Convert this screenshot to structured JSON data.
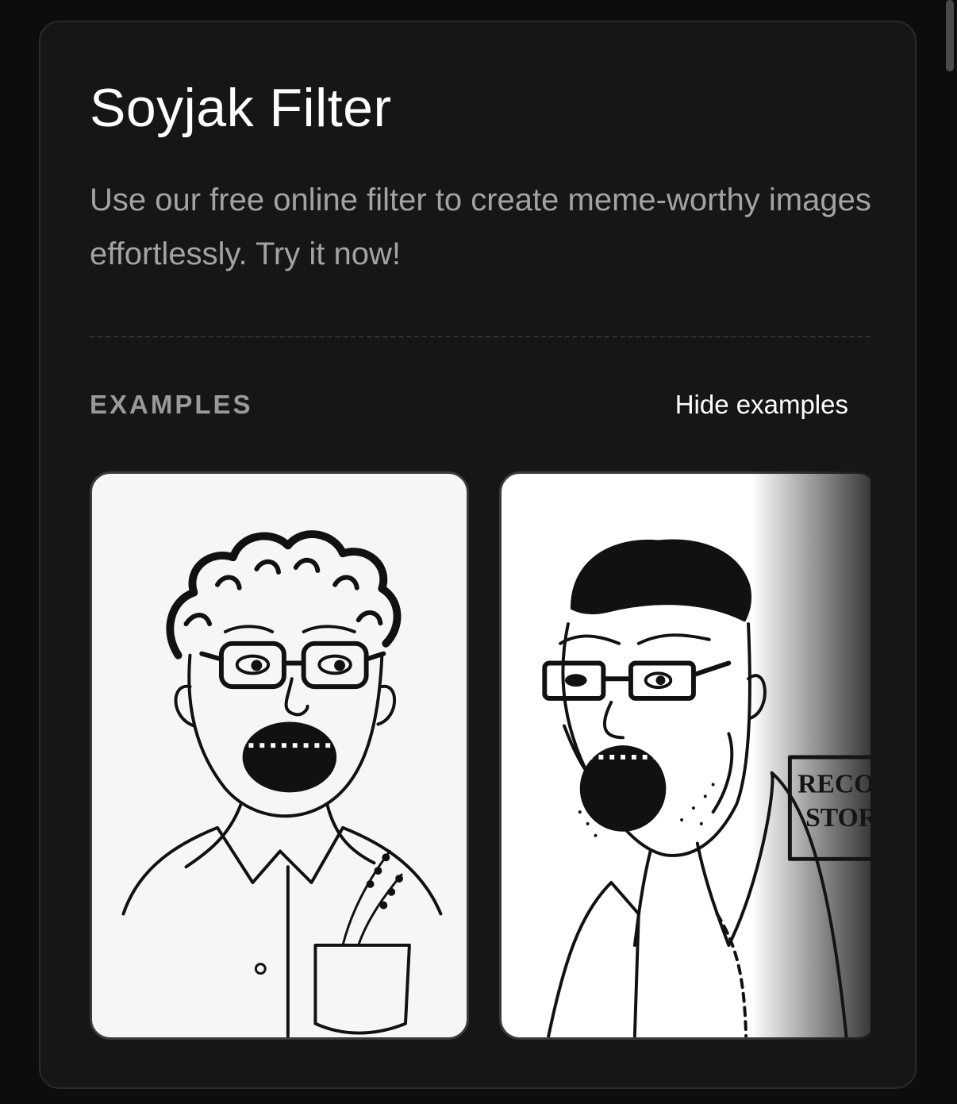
{
  "header": {
    "title": "Soyjak Filter",
    "subtitle": "Use our free online filter to create meme-worthy images effortlessly. Try it now!"
  },
  "examples": {
    "label": "EXAMPLES",
    "toggle_label": "Hide examples",
    "items": [
      {
        "subject": "curly-haired man with glasses and open mouth, shirt pocket with lavender"
      },
      {
        "subject": "short-haired man with glasses and open mouth, record store sign",
        "sign_lines": [
          "RECORD",
          "STORE"
        ]
      }
    ]
  },
  "colors": {
    "background": "#0d0d0d",
    "card": "#161616",
    "title": "#ffffff",
    "muted": "#a3a3a3"
  }
}
